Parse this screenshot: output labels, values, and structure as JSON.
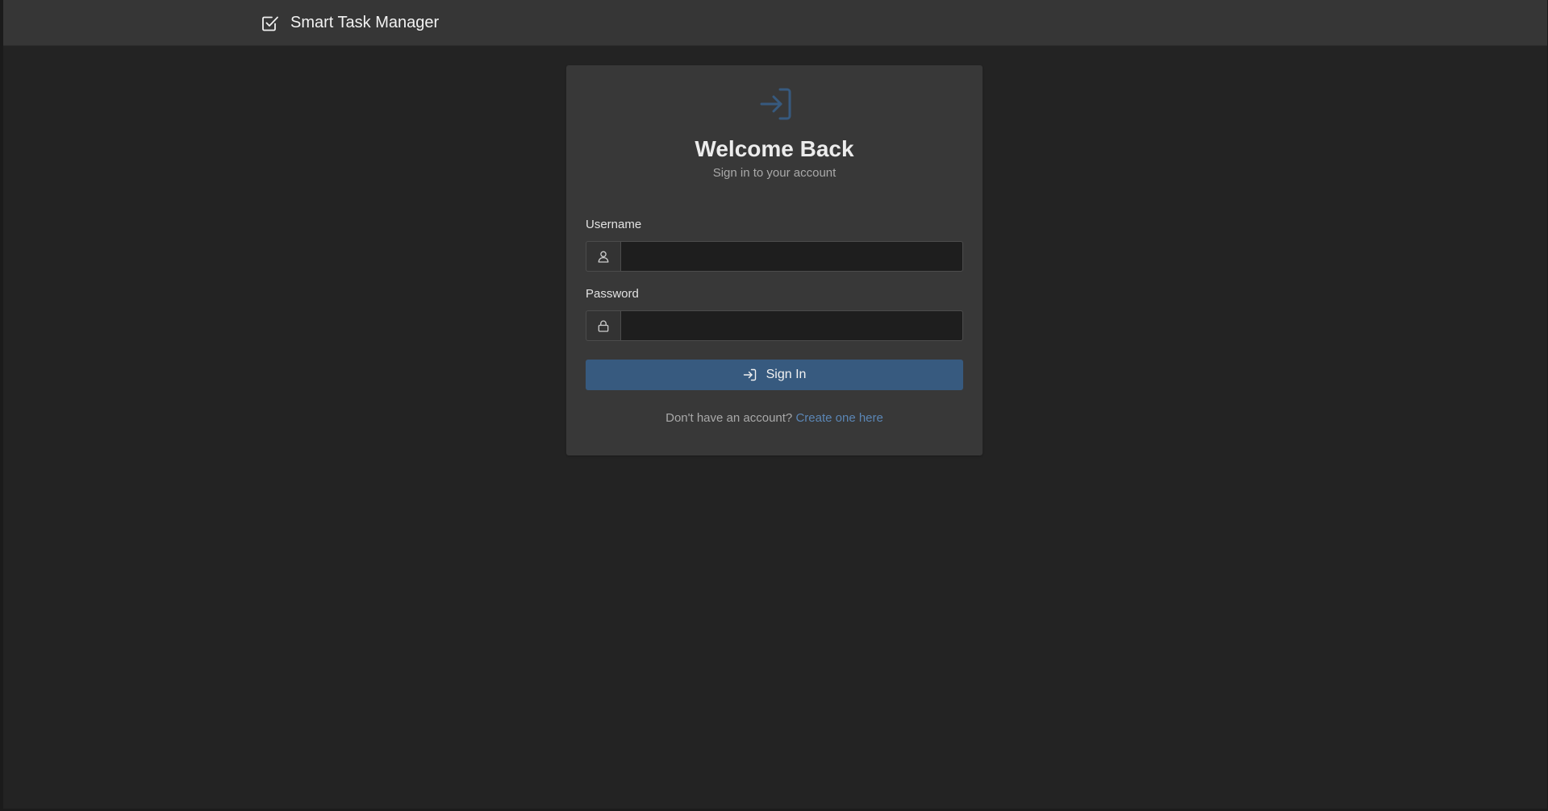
{
  "app": {
    "brand": "Smart Task Manager",
    "brand_icon": "check-square-icon"
  },
  "login": {
    "header_icon": "sign-in-icon",
    "title": "Welcome Back",
    "subtitle": "Sign in to your account",
    "username": {
      "label": "Username",
      "icon": "person-icon",
      "value": "",
      "placeholder": ""
    },
    "password": {
      "label": "Password",
      "icon": "lock-icon",
      "value": "",
      "placeholder": ""
    },
    "submit": {
      "label": "Sign In",
      "icon": "sign-in-icon"
    },
    "footer": {
      "prompt": "Don't have an account?",
      "link_text": "Create one here"
    }
  },
  "colors": {
    "page_background": "#232323",
    "navbar_background": "#363636",
    "card_background": "#383838",
    "primary_button": "#375a7f",
    "accent_icon": "#375a7f",
    "link": "#5b86b5"
  }
}
